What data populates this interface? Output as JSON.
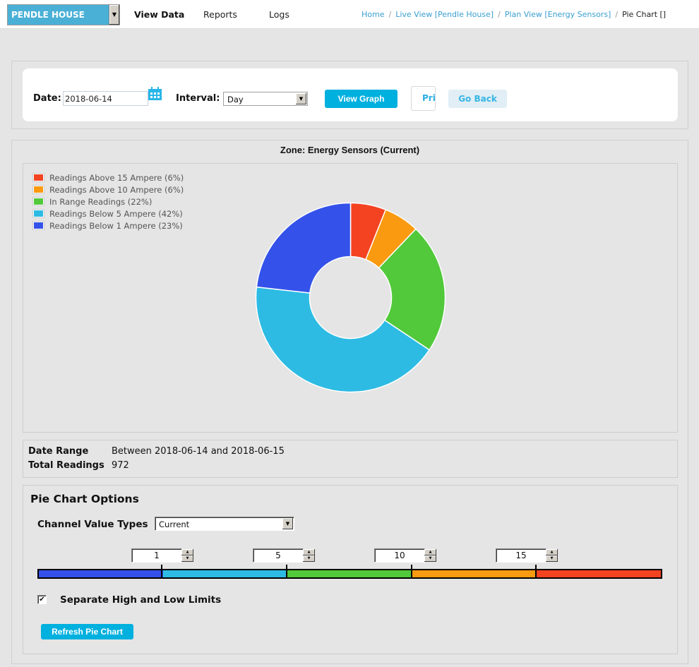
{
  "topbar": {
    "site_selector": "PENDLE HOUSE",
    "nav": [
      "View Data",
      "Reports",
      "Logs"
    ],
    "active_nav": "View Data",
    "breadcrumb": [
      "Home",
      "Live View [Pendle House]",
      "Plan View [Energy Sensors]",
      "Pie Chart []"
    ]
  },
  "filters": {
    "date_label": "Date:",
    "date_value": "2018-06-14",
    "interval_label": "Interval:",
    "interval_value": "Day",
    "view_graph_label": "View Graph",
    "print_label": "Print",
    "go_back_label": "Go Back"
  },
  "chart_data": {
    "type": "pie",
    "variant": "donut",
    "title": "Zone: Energy Sensors (Current)",
    "legend_position": "top-left",
    "categories": [
      "Readings Above 15 Ampere",
      "Readings Above 10 Ampere",
      "In Range Readings",
      "Readings Below 5 Ampere",
      "Readings Below 1 Ampere"
    ],
    "values": [
      6,
      6,
      22,
      42,
      23
    ],
    "legend_labels": [
      "Readings Above 15 Ampere (6%)",
      "Readings Above 10 Ampere (6%)",
      "In Range Readings (22%)",
      "Readings Below 5 Ampere (42%)",
      "Readings Below 1 Ampere (23%)"
    ],
    "colors": [
      "#f34321",
      "#fa9a10",
      "#51c93a",
      "#2ebbe3",
      "#3452ea"
    ],
    "units": "percent",
    "start_angle": "12 o'clock",
    "direction": "clockwise"
  },
  "summary": {
    "date_range_label": "Date Range",
    "date_range_value": "Between 2018-06-14 and 2018-06-15",
    "total_readings_label": "Total Readings",
    "total_readings_value": "972"
  },
  "options": {
    "title": "Pie Chart Options",
    "channel_value_types_label": "Channel Value Types",
    "channel_value_types_value": "Current",
    "thresholds": [
      "1",
      "5",
      "10",
      "15"
    ],
    "range_colors": [
      "#3452ea",
      "#2ebbe3",
      "#51c93a",
      "#fa9a10",
      "#f34321"
    ],
    "separate_limits_label": "Separate High and Low Limits",
    "separate_limits_checked": true,
    "refresh_label": "Refresh Pie Chart"
  }
}
